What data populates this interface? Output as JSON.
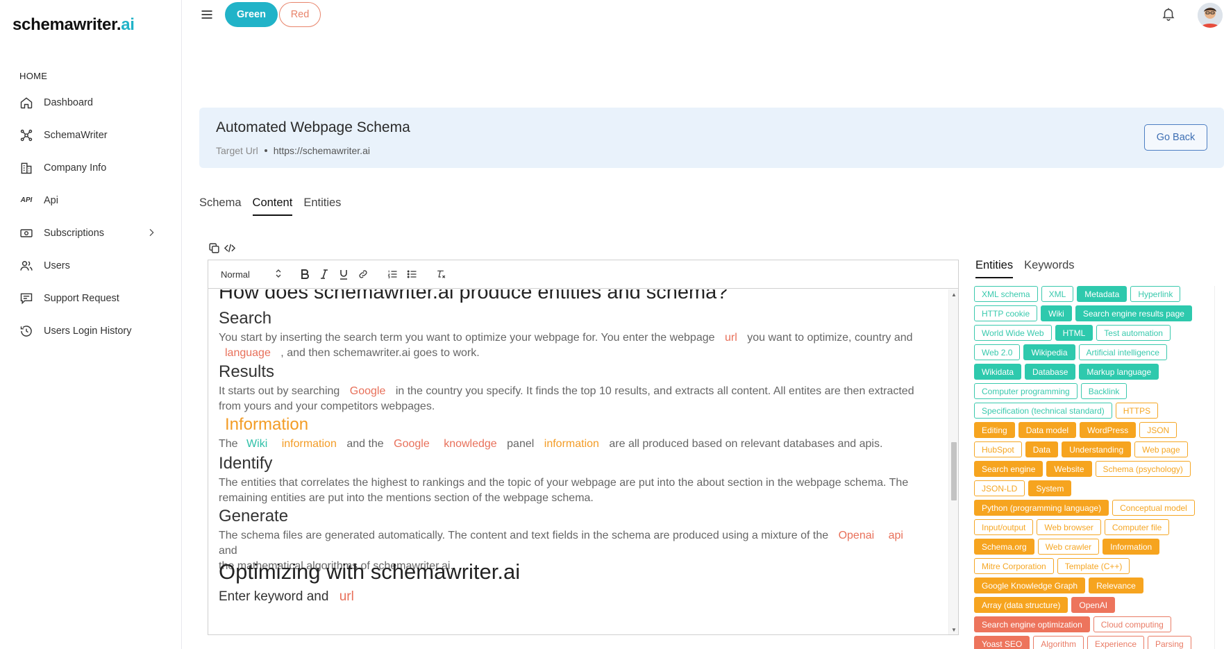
{
  "brand": {
    "name": "schemawriter.",
    "suffix": "ai"
  },
  "sidebar": {
    "heading": "HOME",
    "items": [
      {
        "label": "Dashboard",
        "icon": "home-icon"
      },
      {
        "label": "SchemaWriter",
        "icon": "network-icon"
      },
      {
        "label": "Company Info",
        "icon": "building-icon"
      },
      {
        "label": "Api",
        "icon": "api-icon"
      },
      {
        "label": "Subscriptions",
        "icon": "money-icon"
      },
      {
        "label": "Users",
        "icon": "users-icon"
      },
      {
        "label": "Support Request",
        "icon": "support-icon"
      },
      {
        "label": "Users Login History",
        "icon": "history-icon"
      }
    ],
    "api_icon_text": "API"
  },
  "topbar": {
    "green_label": "Green",
    "red_label": "Red"
  },
  "header": {
    "title": "Automated Webpage Schema",
    "crumb_label": "Target Url",
    "crumb_value": "https://schemawriter.ai",
    "go_back": "Go Back"
  },
  "tabs": [
    "Schema",
    "Content",
    "Entities"
  ],
  "editor": {
    "format": "Normal",
    "cut_heading": "How does schemawriter.ai produce entities and schema?",
    "h_search": "Search",
    "p_search_1": "You start by inserting the search term you want to optimize your webpage for. You enter the webpage",
    "p_search_url": "url",
    "p_search_2": "you want to optimize, country and",
    "p_search_language": "language",
    "p_search_3": ", and then schemawriter.ai goes to work.",
    "h_results": "Results",
    "p_results_1": "It starts out by searching",
    "p_results_google": "Google",
    "p_results_2": "in the country you specify. It finds the top 10 results, and extracts all content. All entites are then extracted from yours and your competitors webpages.",
    "h_information": "Information",
    "p_info_the": "The",
    "p_info_wiki": "Wiki",
    "p_info_information": "information",
    "p_info_andthe": "and the",
    "p_info_google": "Google",
    "p_info_knowledge": "knowledge",
    "p_info_panel": "panel",
    "p_info_information2": "information",
    "p_info_end": "are all produced based on relevant databases and apis.",
    "h_identify": "Identify",
    "p_identify": "The entities that correlates the highest to rankings and the topic of your webpage are put into the about section in the webpage schema. The remaining entities are put into the mentions section of the webpage schema.",
    "h_generate": "Generate",
    "p_generate_1": "The schema files are generated automatically. The content and text fields in the schema are produced using a mixture of the",
    "p_generate_openai": "Openai",
    "p_generate_api": "api",
    "p_generate_and": "and",
    "p_generate_2": "the mathematical algorithms of schemawriter.ai.",
    "h_optimizing": "Optimizing with schemawriter.ai",
    "p_enter": "Enter keyword and",
    "p_enter_url": "url"
  },
  "right_tabs": [
    "Entities",
    "Keywords"
  ],
  "chips": [
    [
      {
        "t": "XML schema",
        "s": "teal-o"
      },
      {
        "t": "XML",
        "s": "teal-o"
      },
      {
        "t": "Metadata",
        "s": "teal-f"
      },
      {
        "t": "Hyperlink",
        "s": "teal-o"
      }
    ],
    [
      {
        "t": "HTTP cookie",
        "s": "teal-o"
      },
      {
        "t": "Wiki",
        "s": "teal-f"
      },
      {
        "t": "Search engine results page",
        "s": "teal-f"
      }
    ],
    [
      {
        "t": "World Wide Web",
        "s": "teal-o"
      },
      {
        "t": "HTML",
        "s": "teal-f"
      },
      {
        "t": "Test automation",
        "s": "teal-o"
      }
    ],
    [
      {
        "t": "Web 2.0",
        "s": "teal-o"
      },
      {
        "t": "Wikipedia",
        "s": "teal-f"
      },
      {
        "t": "Artificial intelligence",
        "s": "teal-o"
      }
    ],
    [
      {
        "t": "Wikidata",
        "s": "teal-f"
      },
      {
        "t": "Database",
        "s": "teal-f"
      },
      {
        "t": "Markup language",
        "s": "teal-f"
      }
    ],
    [
      {
        "t": "Computer programming",
        "s": "teal-o"
      },
      {
        "t": "Backlink",
        "s": "teal-o"
      }
    ],
    [
      {
        "t": "Specification (technical standard)",
        "s": "teal-o"
      },
      {
        "t": "HTTPS",
        "s": "orange-o"
      }
    ],
    [
      {
        "t": "Editing",
        "s": "orange-f"
      },
      {
        "t": "Data model",
        "s": "orange-f"
      },
      {
        "t": "WordPress",
        "s": "orange-f"
      },
      {
        "t": "JSON",
        "s": "orange-o"
      }
    ],
    [
      {
        "t": "HubSpot",
        "s": "orange-o"
      },
      {
        "t": "Data",
        "s": "orange-f"
      },
      {
        "t": "Understanding",
        "s": "orange-f"
      },
      {
        "t": "Web page",
        "s": "orange-o"
      }
    ],
    [
      {
        "t": "Search engine",
        "s": "orange-f"
      },
      {
        "t": "Website",
        "s": "orange-f"
      },
      {
        "t": "Schema (psychology)",
        "s": "orange-o"
      }
    ],
    [
      {
        "t": "JSON-LD",
        "s": "orange-o"
      },
      {
        "t": "System",
        "s": "orange-f"
      }
    ],
    [
      {
        "t": "Python (programming language)",
        "s": "orange-f"
      },
      {
        "t": "Conceptual model",
        "s": "orange-o"
      }
    ],
    [
      {
        "t": "Input/output",
        "s": "orange-o"
      },
      {
        "t": "Web browser",
        "s": "orange-o"
      },
      {
        "t": "Computer file",
        "s": "orange-o"
      }
    ],
    [
      {
        "t": "Schema.org",
        "s": "orange-f"
      },
      {
        "t": "Web crawler",
        "s": "orange-o"
      },
      {
        "t": "Information",
        "s": "orange-f"
      }
    ],
    [
      {
        "t": "Mitre Corporation",
        "s": "orange-o"
      },
      {
        "t": "Template (C++)",
        "s": "orange-o"
      }
    ],
    [
      {
        "t": "Google Knowledge Graph",
        "s": "orange-f"
      },
      {
        "t": "Relevance",
        "s": "orange-f"
      }
    ],
    [
      {
        "t": "Array (data structure)",
        "s": "orange-f"
      },
      {
        "t": "OpenAI",
        "s": "red-f"
      }
    ],
    [
      {
        "t": "Search engine optimization",
        "s": "red-f"
      },
      {
        "t": "Cloud computing",
        "s": "red-o"
      }
    ],
    [
      {
        "t": "Yoast SEO",
        "s": "red-f"
      },
      {
        "t": "Algorithm",
        "s": "red-o"
      },
      {
        "t": "Experience",
        "s": "red-o"
      },
      {
        "t": "Parsing",
        "s": "red-o"
      }
    ]
  ]
}
